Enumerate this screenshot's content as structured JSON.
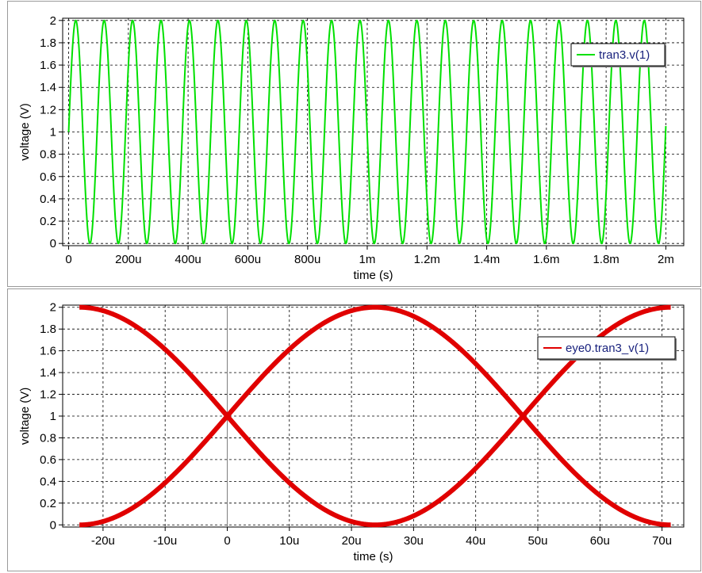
{
  "chart_data": [
    {
      "type": "line",
      "title": "",
      "xlabel": "time (s)",
      "ylabel": "voltage (V)",
      "xlim": [
        -2e-05,
        0.00206
      ],
      "ylim": [
        -0.02,
        2.02
      ],
      "grid": true,
      "legend_position": "top-right",
      "x_ticks": [
        {
          "value": 0,
          "label": "0"
        },
        {
          "value": 0.0002,
          "label": "200u"
        },
        {
          "value": 0.0004,
          "label": "400u"
        },
        {
          "value": 0.0006,
          "label": "600u"
        },
        {
          "value": 0.0008,
          "label": "800u"
        },
        {
          "value": 0.001,
          "label": "1m"
        },
        {
          "value": 0.0012,
          "label": "1.2m"
        },
        {
          "value": 0.0014,
          "label": "1.4m"
        },
        {
          "value": 0.0016,
          "label": "1.6m"
        },
        {
          "value": 0.0018,
          "label": "1.8m"
        },
        {
          "value": 0.002,
          "label": "2m"
        }
      ],
      "y_ticks": [
        {
          "value": 0,
          "label": "0"
        },
        {
          "value": 0.2,
          "label": "0.2"
        },
        {
          "value": 0.4,
          "label": "0.4"
        },
        {
          "value": 0.6,
          "label": "0.6"
        },
        {
          "value": 0.8,
          "label": "0.8"
        },
        {
          "value": 1,
          "label": "1"
        },
        {
          "value": 1.2,
          "label": "1.2"
        },
        {
          "value": 1.4,
          "label": "1.4"
        },
        {
          "value": 1.6,
          "label": "1.6"
        },
        {
          "value": 1.8,
          "label": "1.8"
        },
        {
          "value": 2,
          "label": "2"
        }
      ],
      "series": [
        {
          "name": "tran3.v(1)",
          "color": "#00e000",
          "waveform": "raised-sine",
          "offset": 1,
          "amplitude": 1,
          "period": 9.52e-05,
          "x_start": 0,
          "x_end": 0.002
        }
      ]
    },
    {
      "type": "line",
      "title": "",
      "xlabel": "time (s)",
      "ylabel": "voltage (V)",
      "xlim": [
        -2.65e-05,
        7.35e-05
      ],
      "ylim": [
        -0.02,
        2.02
      ],
      "grid": true,
      "legend_position": "top-right",
      "x_ticks": [
        {
          "value": -2e-05,
          "label": "-20u"
        },
        {
          "value": -1e-05,
          "label": "-10u"
        },
        {
          "value": 0,
          "label": "0"
        },
        {
          "value": 1e-05,
          "label": "10u"
        },
        {
          "value": 2e-05,
          "label": "20u"
        },
        {
          "value": 3e-05,
          "label": "30u"
        },
        {
          "value": 4e-05,
          "label": "40u"
        },
        {
          "value": 5e-05,
          "label": "50u"
        },
        {
          "value": 6e-05,
          "label": "60u"
        },
        {
          "value": 7e-05,
          "label": "70u"
        }
      ],
      "y_ticks": [
        {
          "value": 0,
          "label": "0"
        },
        {
          "value": 0.2,
          "label": "0.2"
        },
        {
          "value": 0.4,
          "label": "0.4"
        },
        {
          "value": 0.6,
          "label": "0.6"
        },
        {
          "value": 0.8,
          "label": "0.8"
        },
        {
          "value": 1,
          "label": "1"
        },
        {
          "value": 1.2,
          "label": "1.2"
        },
        {
          "value": 1.4,
          "label": "1.4"
        },
        {
          "value": 1.6,
          "label": "1.6"
        },
        {
          "value": 1.8,
          "label": "1.8"
        },
        {
          "value": 2,
          "label": "2"
        }
      ],
      "series": [
        {
          "name": "eye0.tran3_v(1)",
          "color": "#e00000",
          "waveform": "eye-diagram",
          "offset": 1,
          "amplitude": 1,
          "crossings": [
            0,
            4.76e-05
          ],
          "x_start": -2.38e-05,
          "x_end": 7.14e-05,
          "peak_at": 2.38e-05
        }
      ]
    }
  ]
}
